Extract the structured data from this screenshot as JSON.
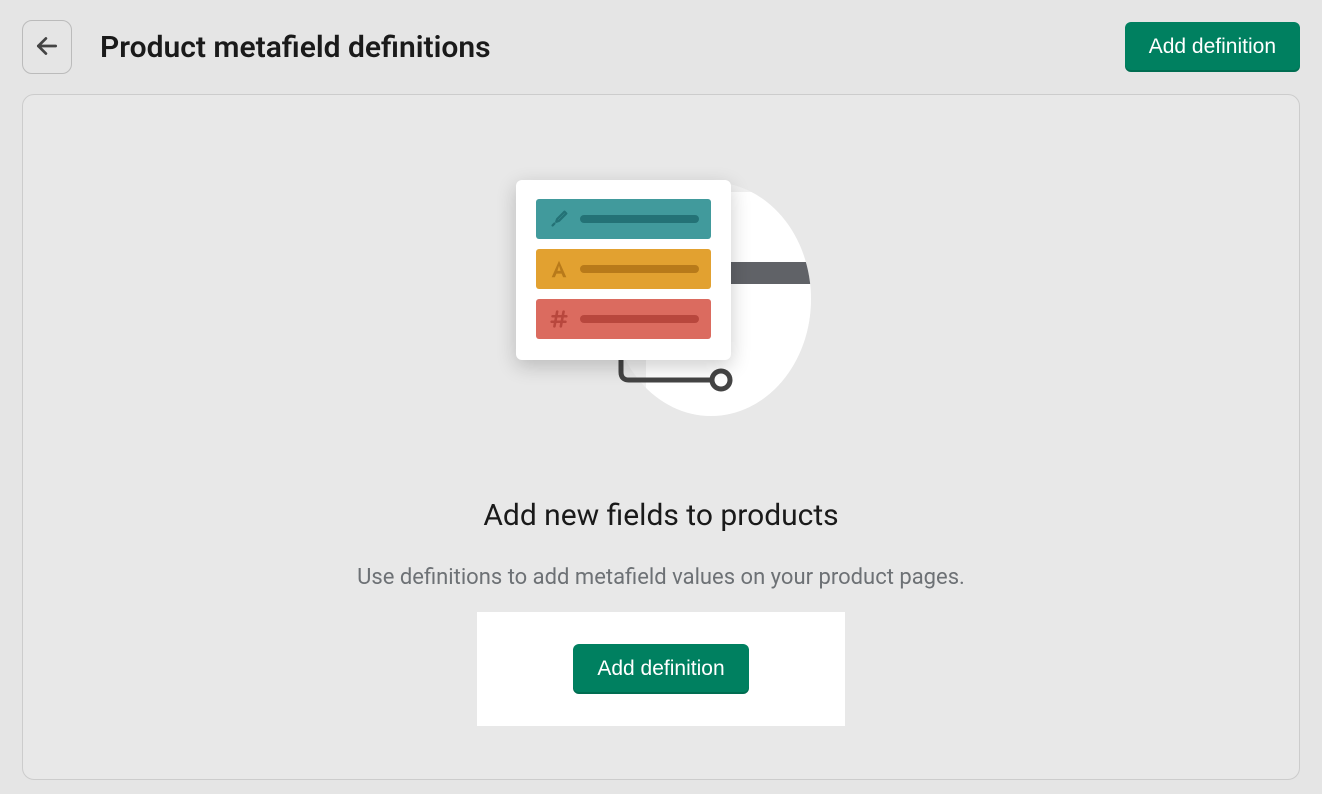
{
  "header": {
    "title": "Product metafield definitions",
    "add_button_label": "Add definition"
  },
  "empty_state": {
    "heading": "Add new fields to products",
    "subtext": "Use definitions to add metafield values on your product pages.",
    "button_label": "Add definition"
  }
}
